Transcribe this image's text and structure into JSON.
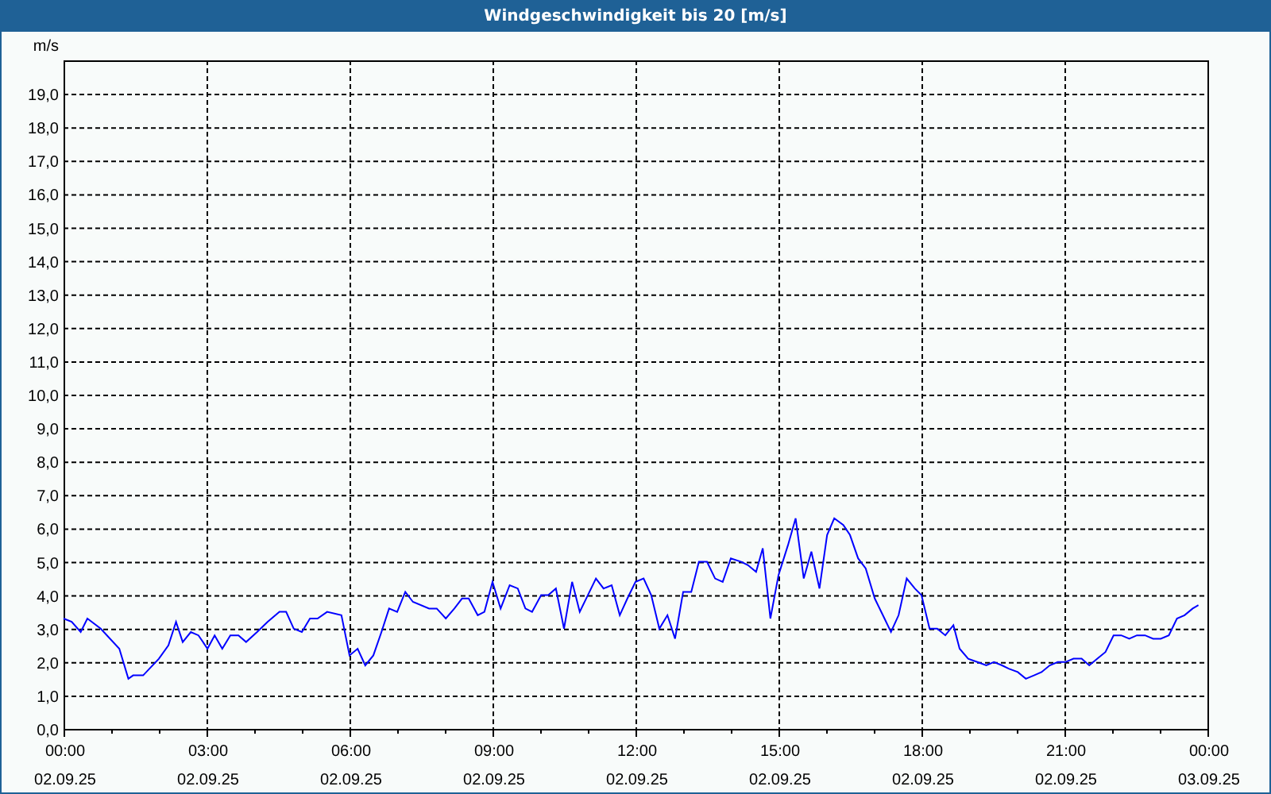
{
  "window": {
    "title": "Windgeschwindigkeit bis 20 [m/s]"
  },
  "chart": {
    "chart_data": {
      "type": "line",
      "ylabel": "m/s",
      "x": [
        0,
        0.17,
        0.36,
        0.5,
        0.78,
        1.17,
        1.36,
        1.46,
        1.67,
        2,
        2.2,
        2.36,
        2.5,
        2.67,
        2.83,
        3.02,
        3.17,
        3.33,
        3.5,
        3.67,
        3.83,
        4.06,
        4.28,
        4.53,
        4.67,
        4.83,
        5,
        5.17,
        5.33,
        5.53,
        5.83,
        6,
        6.17,
        6.33,
        6.5,
        6.67,
        6.83,
        7,
        7.17,
        7.33,
        7.67,
        7.83,
        8.02,
        8.2,
        8.36,
        8.5,
        8.69,
        8.83,
        9,
        9.17,
        9.36,
        9.53,
        9.69,
        9.83,
        10.02,
        10.17,
        10.33,
        10.5,
        10.67,
        10.83,
        11,
        11.17,
        11.33,
        11.5,
        11.67,
        11.83,
        12,
        12.17,
        12.33,
        12.5,
        12.67,
        12.83,
        13,
        13.17,
        13.33,
        13.5,
        13.67,
        13.83,
        14,
        14.22,
        14.36,
        14.53,
        14.67,
        14.83,
        15,
        15.2,
        15.36,
        15.53,
        15.69,
        15.86,
        16.02,
        16.17,
        16.36,
        16.5,
        16.67,
        16.83,
        17.02,
        17.19,
        17.36,
        17.52,
        17.69,
        17.86,
        18,
        18.17,
        18.33,
        18.5,
        18.67,
        18.8,
        18.98,
        19.17,
        19.36,
        19.52,
        19.69,
        19.83,
        20.02,
        20.19,
        20.36,
        20.52,
        20.69,
        20.86,
        21.02,
        21.19,
        21.36,
        21.52,
        21.69,
        21.86,
        22.03,
        22.19,
        22.36,
        22.52,
        22.69,
        22.86,
        23.02,
        23.19,
        23.36,
        23.52,
        23.69,
        23.81
      ],
      "grid": true,
      "series": [
        {
          "color": "#0000ff",
          "values": [
            3.3,
            3.2,
            2.9,
            3.3,
            3,
            2.4,
            1.5,
            1.6,
            1.6,
            2.1,
            2.5,
            3.2,
            2.6,
            2.9,
            2.8,
            2.4,
            2.8,
            2.4,
            2.8,
            2.8,
            2.6,
            2.9,
            3.2,
            3.5,
            3.5,
            3,
            2.9,
            3.3,
            3.3,
            3.5,
            3.4,
            2.2,
            2.4,
            1.9,
            2.2,
            2.9,
            3.6,
            3.5,
            4.1,
            3.8,
            3.6,
            3.6,
            3.3,
            3.6,
            3.9,
            3.9,
            3.4,
            3.5,
            4.4,
            3.6,
            4.3,
            4.2,
            3.6,
            3.5,
            4,
            4,
            4.2,
            3,
            4.4,
            3.5,
            4,
            4.5,
            4.2,
            4.3,
            3.4,
            3.9,
            4.4,
            4.5,
            4,
            3,
            3.4,
            2.7,
            4.1,
            4.1,
            5,
            5,
            4.5,
            4.4,
            5.1,
            5,
            4.9,
            4.7,
            5.4,
            3.3,
            4.6,
            5.5,
            6.3,
            4.5,
            5.3,
            4.2,
            5.8,
            6.3,
            6.1,
            5.8,
            5.1,
            4.8,
            3.9,
            3.4,
            2.9,
            3.4,
            4.5,
            4.2,
            4,
            3,
            3,
            2.8,
            3.1,
            2.4,
            2.1,
            2,
            1.9,
            2,
            1.9,
            1.8,
            1.7,
            1.5,
            1.6,
            1.7,
            1.9,
            2,
            2,
            2.1,
            2.1,
            1.9,
            2.1,
            2.3,
            2.8,
            2.8,
            2.7,
            2.8,
            2.8,
            2.7,
            2.7,
            2.8,
            3.3,
            3.4,
            3.6,
            3.7
          ]
        }
      ],
      "xlim": [
        0,
        24
      ],
      "ylim": [
        0,
        20
      ],
      "xticks": [
        {
          "value": 0,
          "label": "00:00"
        },
        {
          "value": 3,
          "label": "03:00"
        },
        {
          "value": 6,
          "label": "06:00"
        },
        {
          "value": 9,
          "label": "09:00"
        },
        {
          "value": 12,
          "label": "12:00"
        },
        {
          "value": 15,
          "label": "15:00"
        },
        {
          "value": 18,
          "label": "18:00"
        },
        {
          "value": 21,
          "label": "21:00"
        },
        {
          "value": 24,
          "label": "00:00"
        }
      ],
      "annotations": [
        "02.09.25",
        "02.09.25",
        "02.09.25",
        "02.09.25",
        "02.09.25",
        "02.09.25",
        "02.09.25",
        "02.09.25",
        "03.09.25"
      ],
      "yticks": [
        {
          "value": 0,
          "label": "0,0"
        },
        {
          "value": 1,
          "label": "1,0"
        },
        {
          "value": 2,
          "label": "2,0"
        },
        {
          "value": 3,
          "label": "3,0"
        },
        {
          "value": 4,
          "label": "4,0"
        },
        {
          "value": 5,
          "label": "5,0"
        },
        {
          "value": 6,
          "label": "6,0"
        },
        {
          "value": 7,
          "label": "7,0"
        },
        {
          "value": 8,
          "label": "8,0"
        },
        {
          "value": 9,
          "label": "9,0"
        },
        {
          "value": 10,
          "label": "10,0"
        },
        {
          "value": 11,
          "label": "11,0"
        },
        {
          "value": 12,
          "label": "12,0"
        },
        {
          "value": 13,
          "label": "13,0"
        },
        {
          "value": 14,
          "label": "14,0"
        },
        {
          "value": 15,
          "label": "15,0"
        },
        {
          "value": 16,
          "label": "16,0"
        },
        {
          "value": 17,
          "label": "17,0"
        },
        {
          "value": 18,
          "label": "18,0"
        },
        {
          "value": 19,
          "label": "19,0"
        }
      ]
    }
  }
}
